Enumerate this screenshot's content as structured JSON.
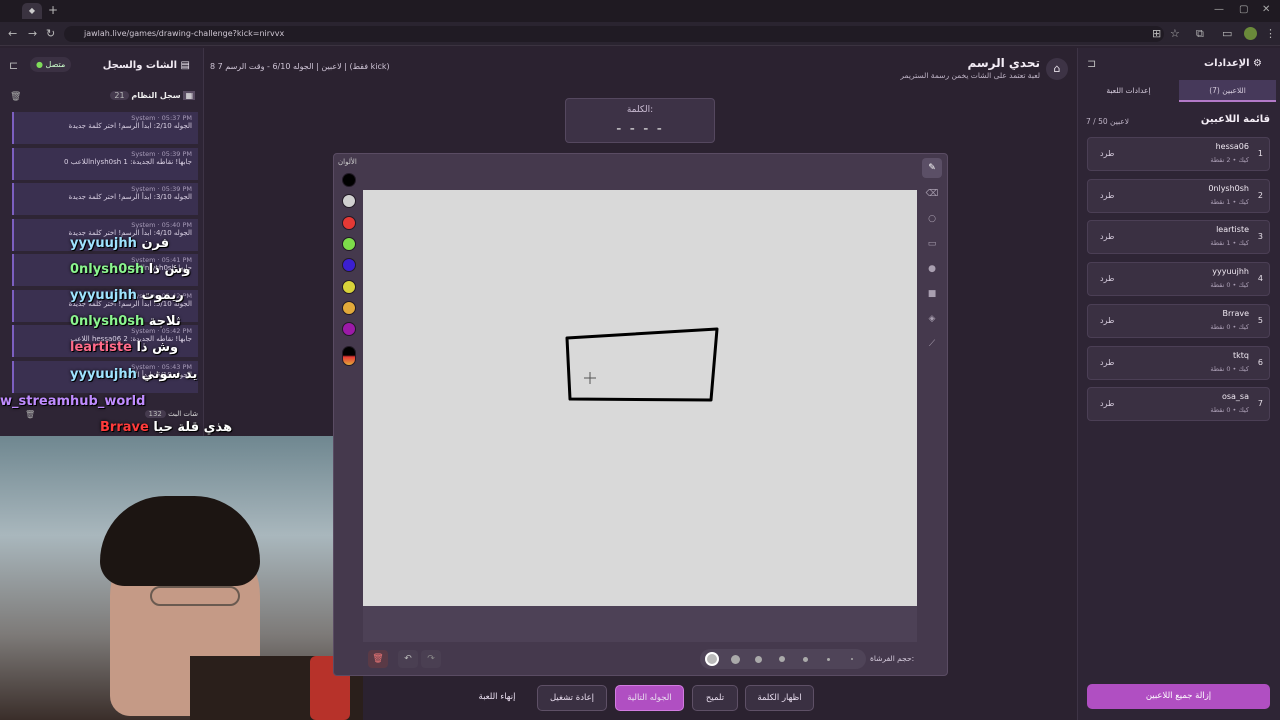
{
  "browser": {
    "url": "jawlah.live/games/drawing-challenge?kick=nirvvx"
  },
  "left_panel": {
    "title": "الشات والسجل",
    "status": "متصل",
    "system_log": {
      "label": "سجل النظام",
      "count": "21"
    },
    "log_items": [
      {
        "meta": "System · 05:37 PM",
        "text": "الجوله 2/10: ابدأ الرسم! اختر كلمة جديدة"
      },
      {
        "meta": "System · 05:39 PM",
        "text": "اللاعب 0nlysh0sh جابها! نقاطه الجديدة: 1"
      },
      {
        "meta": "System · 05:39 PM",
        "text": "الجوله 3/10: ابدأ الرسم! اختر كلمة جديدة"
      },
      {
        "meta": "System · 05:40 PM",
        "text": "الجوله 4/10: ابدأ الرسم! اختر كلمة جديدة"
      },
      {
        "meta": "System · 05:41 PM",
        "text": "اللاعب 0nlysh0sh جابها"
      },
      {
        "meta": "System · 05:42 PM",
        "text": "الجوله 5/10: ابدأ الرسم! اختر كلمة جديدة"
      },
      {
        "meta": "System · 05:42 PM",
        "text": "اللاعب hessa06 جابها! نقاطه الجديدة: 2"
      },
      {
        "meta": "System · 05:43 PM",
        "text": "الجوله 6/10: ابدأ الرسم"
      }
    ],
    "chat_footer": {
      "label": "شات البث",
      "count": "132"
    },
    "overlay_chat": [
      {
        "user": "yyyuujhh",
        "msg": "فرن",
        "color": "#9fe3ff"
      },
      {
        "user": "0nlysh0sh",
        "msg": "وش ذا",
        "color": "#8bf58f"
      },
      {
        "user": "yyyuujhh",
        "msg": "ريموت",
        "color": "#9fe3ff"
      },
      {
        "user": "0nlysh0sh",
        "msg": "ثلاجة",
        "color": "#8bf58f"
      },
      {
        "user": "leartiste",
        "msg": "وش ذا",
        "color": "#ff6b8a"
      },
      {
        "user": "yyyuujhh",
        "msg": "يد سوني",
        "color": "#9fe3ff"
      },
      {
        "user": "w_streamhub_world",
        "msg": "",
        "color": "#c08cff"
      },
      {
        "user": "Brrave",
        "msg": "هذي قلة حيا",
        "color": "#ff3b3b"
      }
    ]
  },
  "header": {
    "title": "تحدي الرسم",
    "subtitle": "لعبة تعتمد على الشات يخمن رسمة الستريمر",
    "info": "8 7 لاعبين | الجوله 6/10 - وقت الرسم | (فقط kick)"
  },
  "word": {
    "label": "الكلمة:",
    "blanks": "- - - -"
  },
  "canvas": {
    "colors_label": "الألوان",
    "colors": [
      "#000000",
      "#d0d0d0",
      "#e53935",
      "#7ddc4a",
      "#3b1fd1",
      "#d8d23a",
      "#e2a93a",
      "#9c1aa8"
    ],
    "brush_size_label": "حجم الفرشاة:"
  },
  "buttons": {
    "end_game": "إنهاء اللعبة",
    "restart": "إعادة تشغيل",
    "next_round": "الجوله التالية",
    "hint": "تلميح",
    "reveal_word": "اظهار الكلمة"
  },
  "right_panel": {
    "title": "الإعدادات",
    "tabs": {
      "players": "اللاعبين (7)",
      "game_settings": "إعدادات اللعبة"
    },
    "list_title": "قائمة اللاعبين",
    "capacity": "7 / 50 لاعبين",
    "kick_label": "طرد",
    "players": [
      {
        "rank": "1",
        "name": "hessa06",
        "points": "كيك • 2 نقطة"
      },
      {
        "rank": "2",
        "name": "0nlysh0sh",
        "points": "كيك • 1 نقطة"
      },
      {
        "rank": "3",
        "name": "leartiste",
        "points": "كيك • 1 نقطة"
      },
      {
        "rank": "4",
        "name": "yyyuujhh",
        "points": "كيك • 0 نقطة"
      },
      {
        "rank": "5",
        "name": "Brrave",
        "points": "كيك • 0 نقطة"
      },
      {
        "rank": "6",
        "name": "tktq",
        "points": "كيك • 0 نقطة"
      },
      {
        "rank": "7",
        "name": "osa_sa",
        "points": "كيك • 0 نقطة"
      }
    ],
    "remove_all": "إزالة جميع اللاعبين"
  }
}
